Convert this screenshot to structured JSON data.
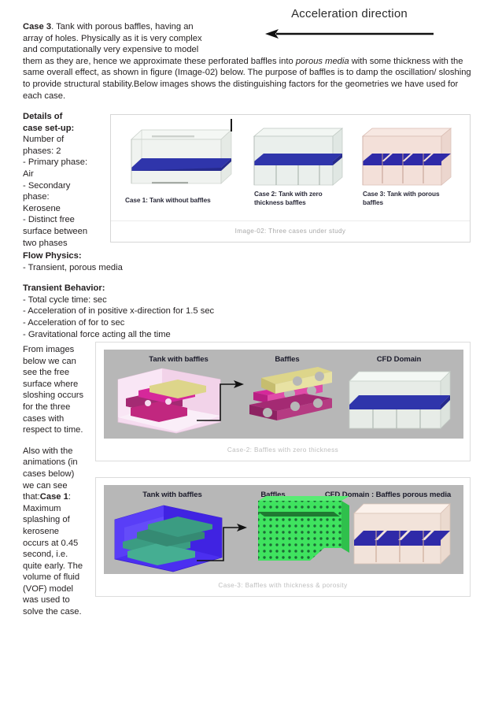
{
  "accel_banner": {
    "label": "Acceleration direction",
    "arrow_icon": "left-arrow-icon"
  },
  "intro": {
    "case_label": "Case 3",
    "line1": ". Tank with porous baffles, having an",
    "line2": "array of holes. Physically as it is very complex",
    "line3": "and computationally very expensive to model",
    "line4a": "them as they are, hence we approximate these perforated baffles into ",
    "line4_italic": "porous media",
    "line4b": " with some thickness with the",
    "line5": "same overall effect, as shown in figure (Image-02) below. The purpose of baffles is to damp the oscillation/ sloshing",
    "line6": "to provide structural stability.Below images shows the distinguishing factors for the geometries we have used for",
    "line7": "each case."
  },
  "details": {
    "heading": "Details of\ncase set-up:",
    "body": "Number of\nphases: 2\n- Primary phase:\nAir\n- Secondary\nphase:\nKerosene\n- Distinct free\nsurface between\ntwo phases"
  },
  "flow_physics": {
    "heading": "Flow Physics:",
    "body": "- Transient, porous media"
  },
  "transient": {
    "heading": "Transient Behavior:",
    "body": "- Total cycle time: sec\n- Acceleration of in positive x-direction for 1.5 sec\n- Acceleration of for to sec\n- Gravitational force acting all the time"
  },
  "narrative": {
    "para1": "From images\nbelow we can\nsee the free\nsurface where\nsloshing occurs\nfor the three\ncases with\nrespect to time.",
    "para2_pre": "Also with the\nanimations (in\ncases below)\nwe can see\nthat:",
    "para2_bold": "Case 1",
    "para2_post": ":\nMaximum\nsplashing of\nkerosene\noccurs at 0.45\nsecond, i.e.\nquite early. The\nvolume of fluid\n(VOF) model\nwas used to\nsolve the case."
  },
  "figure_image02": {
    "caption": "Image-02: Three cases under study",
    "tanks": [
      {
        "label": "Case 1: Tank without baffles",
        "shell_color": "#eef1ee",
        "fluid_color": "#2f35ab",
        "baffles": 0
      },
      {
        "label": "Case 2: Tank with zero\nthickness baffles",
        "shell_color": "#e7ede9",
        "fluid_color": "#2f35ab",
        "baffles": 3
      },
      {
        "label": "Case 3: Tank with porous\nbaffles",
        "shell_color": "#f2ddd5",
        "fluid_color": "#2f35ab",
        "baffles": 3
      }
    ]
  },
  "figure_case2": {
    "caption": "Case-2: Baffles with zero thickness",
    "panels": [
      {
        "title": "Tank with baffles"
      },
      {
        "title": "Baffles"
      },
      {
        "title": "CFD Domain"
      }
    ],
    "colors": {
      "tank": "#f6dcf0",
      "baffle_magenta": "#d6289a",
      "baffle_dark": "#a42a73",
      "baffle_khaki": "#ddd58a",
      "domain_shell": "#edf2ed",
      "domain_fluid": "#2f35ab",
      "background": "#b7b7b7"
    }
  },
  "figure_case3": {
    "caption": "Case-3: Baffles with thickness & porosity",
    "panels": [
      {
        "title": "Tank with baffles"
      },
      {
        "title": "Baffles"
      },
      {
        "title": "CFD Domain : Baffles porous media"
      }
    ],
    "colors": {
      "tank": "#4b2ff0",
      "tank_dark": "#3a1fd0",
      "baffle_teal": "#3b9c82",
      "porous_green": "#3fe35f",
      "porous_dot": "#1c6b35",
      "domain_shell": "#f7e7dd",
      "domain_fluid": "#2f2aa8",
      "background": "#b7b7b7"
    }
  }
}
